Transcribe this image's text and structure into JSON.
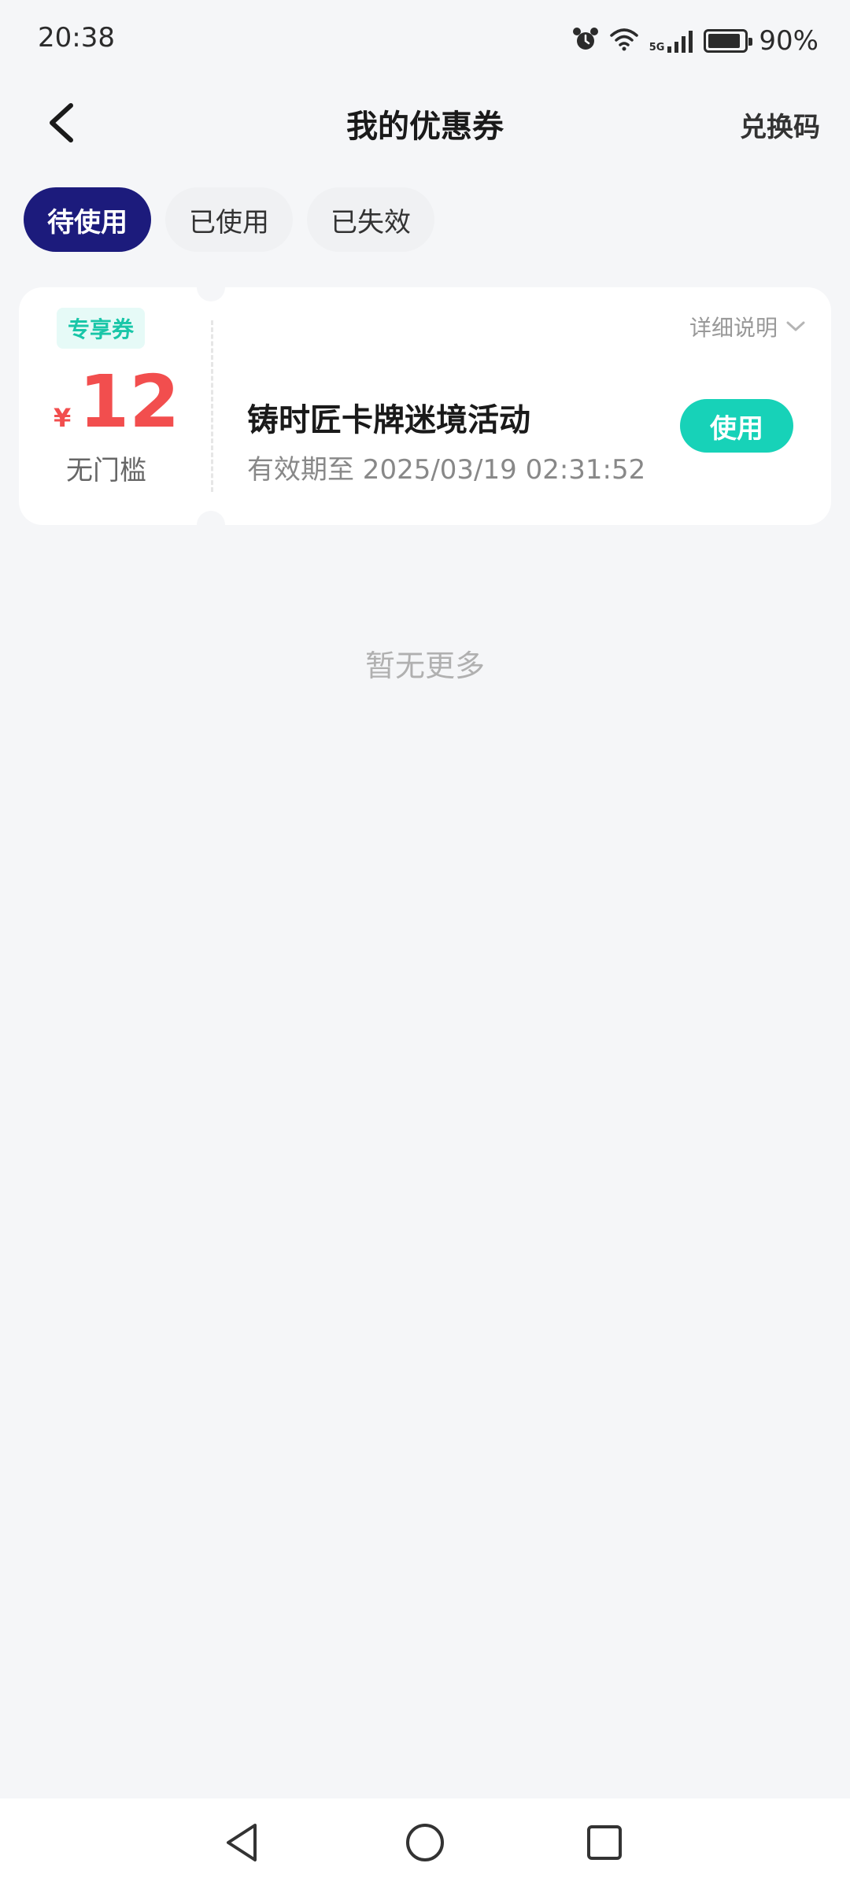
{
  "status_bar": {
    "time": "20:38",
    "network": "5G",
    "battery_text": "90%",
    "battery_level": 0.9,
    "icons": [
      "alarm-icon",
      "wifi-icon",
      "signal-icon",
      "battery-icon"
    ]
  },
  "header": {
    "back_icon": "chevron-left-icon",
    "title": "我的优惠券",
    "redeem_label": "兑换码"
  },
  "tabs": [
    {
      "label": "待使用",
      "active": true
    },
    {
      "label": "已使用",
      "active": false
    },
    {
      "label": "已失效",
      "active": false
    }
  ],
  "coupon": {
    "tag": "专享券",
    "currency": "¥",
    "amount": "12",
    "threshold": "无门槛",
    "details_label": "详细说明",
    "title": "铸时匠卡牌迷境活动",
    "expiry": "有效期至 2025/03/19 02:31:52",
    "use_label": "使用"
  },
  "footer": {
    "no_more": "暂无更多"
  },
  "colors": {
    "accent": "#1c1b7c",
    "use_button": "#17d2b8",
    "amount": "#f24e4e",
    "tag": "#19c6a8",
    "background": "#f5f6f8"
  }
}
